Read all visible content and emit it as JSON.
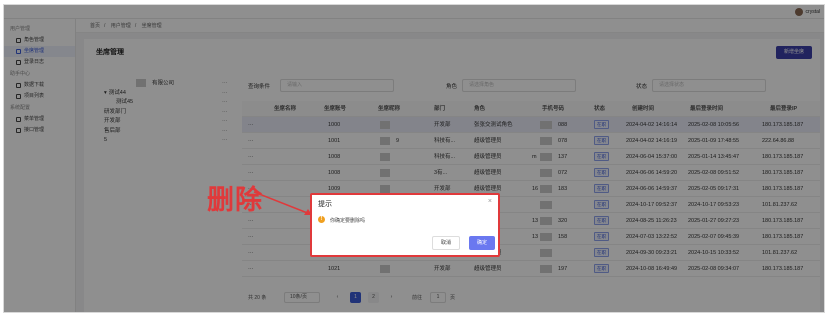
{
  "topbar": {
    "username": "crystal"
  },
  "sidebar": {
    "groups": [
      {
        "label": "用户管理",
        "items": [
          {
            "label": "角色管理",
            "active": false
          },
          {
            "label": "坐席管理",
            "active": true
          },
          {
            "label": "登录日志",
            "active": false
          }
        ]
      },
      {
        "label": "助手中心",
        "items": [
          {
            "label": "数据下载",
            "active": false
          },
          {
            "label": "项目列表",
            "active": false
          }
        ]
      },
      {
        "label": "系统配置",
        "items": [
          {
            "label": "菜单管理",
            "active": false
          },
          {
            "label": "接口管理",
            "active": false
          }
        ]
      }
    ]
  },
  "breadcrumb": [
    "首页",
    "用户管理",
    "坐席管理"
  ],
  "page": {
    "title": "坐席管理",
    "new_button": "新增坐席"
  },
  "tree": {
    "nodes": [
      "有限公司",
      "测试44",
      "测试45",
      "研发部门",
      "开发部",
      "售后部",
      "5"
    ],
    "more_label": "···"
  },
  "filters": {
    "query_label": "查询条件",
    "query_placeholder": "请输入",
    "role_label": "角色",
    "role_placeholder": "请选择角色",
    "status_label": "状态",
    "status_placeholder": "请选择状态"
  },
  "table": {
    "headers": [
      "坐席名称",
      "坐席账号",
      "坐席昵称",
      "部门",
      "角色",
      "手机号码",
      "状态",
      "创建时间",
      "最后登录时间",
      "最后登录IP"
    ],
    "rows": [
      {
        "account": "1000",
        "dept": "开发部",
        "role": "张张交测试角色",
        "phone": "088",
        "status": "在职",
        "created": "2024-04-02 14:16:14",
        "last_login": "2025-02-08 10:05:56",
        "ip": "180.173.185.187"
      },
      {
        "account": "1001",
        "nick": "9",
        "dept": "科技有...",
        "role": "超级管理员",
        "phone": "078",
        "status": "在职",
        "created": "2024-04-02 14:16:19",
        "last_login": "2025-01-09 17:48:55",
        "ip": "222.64.86.88"
      },
      {
        "account": "1008",
        "dept": "科技有...",
        "role": "超级管理员",
        "phone": "137",
        "phone_prefix": "m",
        "status": "在职",
        "created": "2024-06-04 15:37:00",
        "last_login": "2025-01-14 13:45:47",
        "ip": "180.173.185.187"
      },
      {
        "account": "1008",
        "dept": "3有...",
        "role": "超级管理员",
        "phone": "072",
        "status": "在职",
        "created": "2024-06-06 14:59:20",
        "last_login": "2025-02-08 09:51:52",
        "ip": "180.173.185.187"
      },
      {
        "account": "1009",
        "dept": "开发部",
        "role": "超级管理员",
        "phone": "183",
        "phone_prefix": "16",
        "status": "在职",
        "created": "2024-06-06 14:59:37",
        "last_login": "2025-02-05 09:17:31",
        "ip": "180.173.185.187"
      },
      {
        "account": "",
        "dept": "",
        "role": "",
        "phone": "",
        "status": "在职",
        "created": "2024-10-17 09:52:37",
        "last_login": "2024-10-17 09:53:23",
        "ip": "101.81.237.62"
      },
      {
        "account": "",
        "dept": "",
        "role": "",
        "phone": "320",
        "phone_prefix": "13",
        "status": "在职",
        "created": "2024-08-25 11:26:23",
        "last_login": "2025-01-27 09:27:23",
        "ip": "180.173.185.187"
      },
      {
        "account": "",
        "dept": "",
        "role": "",
        "phone": "158",
        "phone_prefix": "13",
        "status": "在职",
        "created": "2024-07-03 13:22:52",
        "last_login": "2025-02-07 09:45:39",
        "ip": "180.173.185.187"
      },
      {
        "account": "1020",
        "dept": "开发部",
        "role": "超级管理员",
        "phone": "",
        "status": "在职",
        "created": "2024-09-30 09:23:21",
        "last_login": "2024-10-15 10:33:52",
        "ip": "101.81.237.62"
      },
      {
        "account": "1021",
        "dept": "开发部",
        "role": "超级管理员",
        "phone": "197",
        "status": "在职",
        "created": "2024-10-08 16:49:49",
        "last_login": "2025-02-08 09:34:07",
        "ip": "180.173.185.187"
      }
    ],
    "more_label": "···"
  },
  "pagination": {
    "total": "共 20 条",
    "page_size": "10条/页",
    "prev": "‹",
    "pages": [
      "1",
      "2"
    ],
    "current": "1",
    "next": "›",
    "goto_label": "前往",
    "goto_value": "1",
    "goto_suffix": "页"
  },
  "dialog": {
    "title": "提示",
    "close": "×",
    "icon": "!",
    "message": "你确定要删除吗",
    "cancel": "取消",
    "confirm": "确定"
  },
  "annotation": {
    "text": "删除",
    "color": "#e0393b"
  },
  "colors": {
    "primary": "#3b5bd6",
    "annotation": "#e0393b",
    "warning": "#f0a020"
  }
}
